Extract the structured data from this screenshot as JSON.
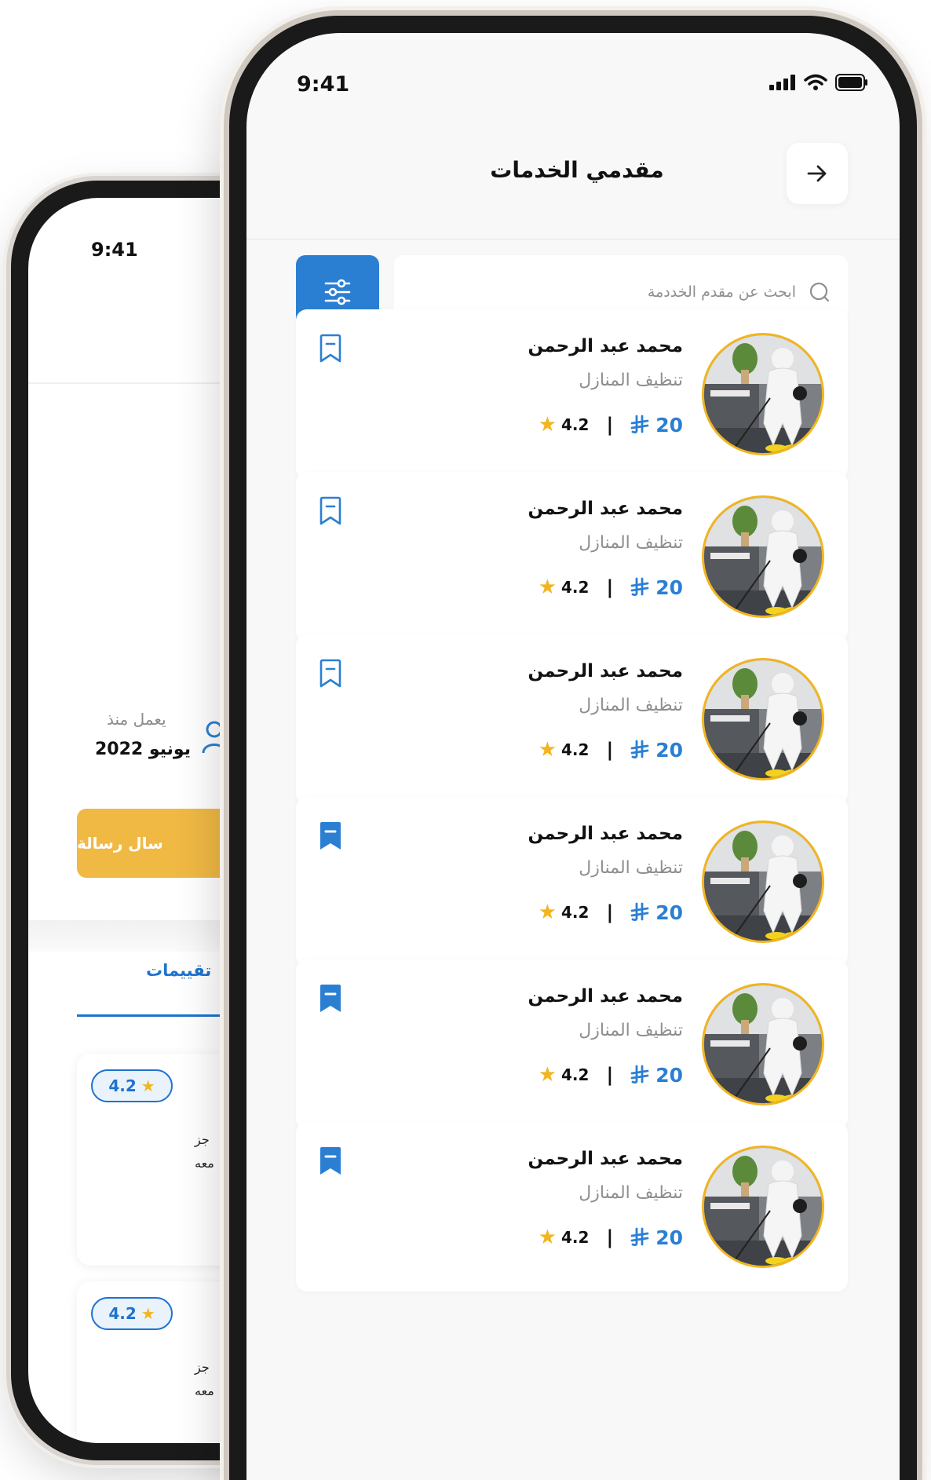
{
  "back_phone": {
    "status_time": "9:41",
    "since_label": "يعمل منذ",
    "since_value": "يونيو 2022",
    "message_button": "سال رسالة",
    "tab_label": "تقييمات",
    "reviews": [
      {
        "rating": "4.2",
        "line1": "جز",
        "line2": "معه"
      },
      {
        "rating": "4.2",
        "line1": "جز",
        "line2": "معه"
      }
    ]
  },
  "front_phone": {
    "status_time": "9:41",
    "title": "مقدمي الخدمات",
    "search_placeholder": "ابحث عن مقدم الخددمة",
    "providers": [
      {
        "name": "محمد عبد الرحمن",
        "service": "تنظيف المنازل",
        "price": "20",
        "rating": "4.2",
        "bookmarked": false
      },
      {
        "name": "محمد عبد الرحمن",
        "service": "تنظيف المنازل",
        "price": "20",
        "rating": "4.2",
        "bookmarked": false
      },
      {
        "name": "محمد عبد الرحمن",
        "service": "تنظيف المنازل",
        "price": "20",
        "rating": "4.2",
        "bookmarked": false
      },
      {
        "name": "محمد عبد الرحمن",
        "service": "تنظيف المنازل",
        "price": "20",
        "rating": "4.2",
        "bookmarked": true
      },
      {
        "name": "محمد عبد الرحمن",
        "service": "تنظيف المنازل",
        "price": "20",
        "rating": "4.2",
        "bookmarked": true
      },
      {
        "name": "محمد عبد الرحمن",
        "service": "تنظيف المنازل",
        "price": "20",
        "rating": "4.2",
        "bookmarked": true
      }
    ]
  },
  "colors": {
    "primary": "#2b7fd3",
    "accent": "#f2b51f",
    "button_yellow": "#f0b944"
  },
  "icons": [
    "arrow-right-icon",
    "filter-sliders-icon",
    "search-icon",
    "bookmark-icon",
    "star-icon",
    "riyal-icon",
    "user-icon",
    "signal-icon",
    "wifi-icon",
    "battery-icon"
  ]
}
